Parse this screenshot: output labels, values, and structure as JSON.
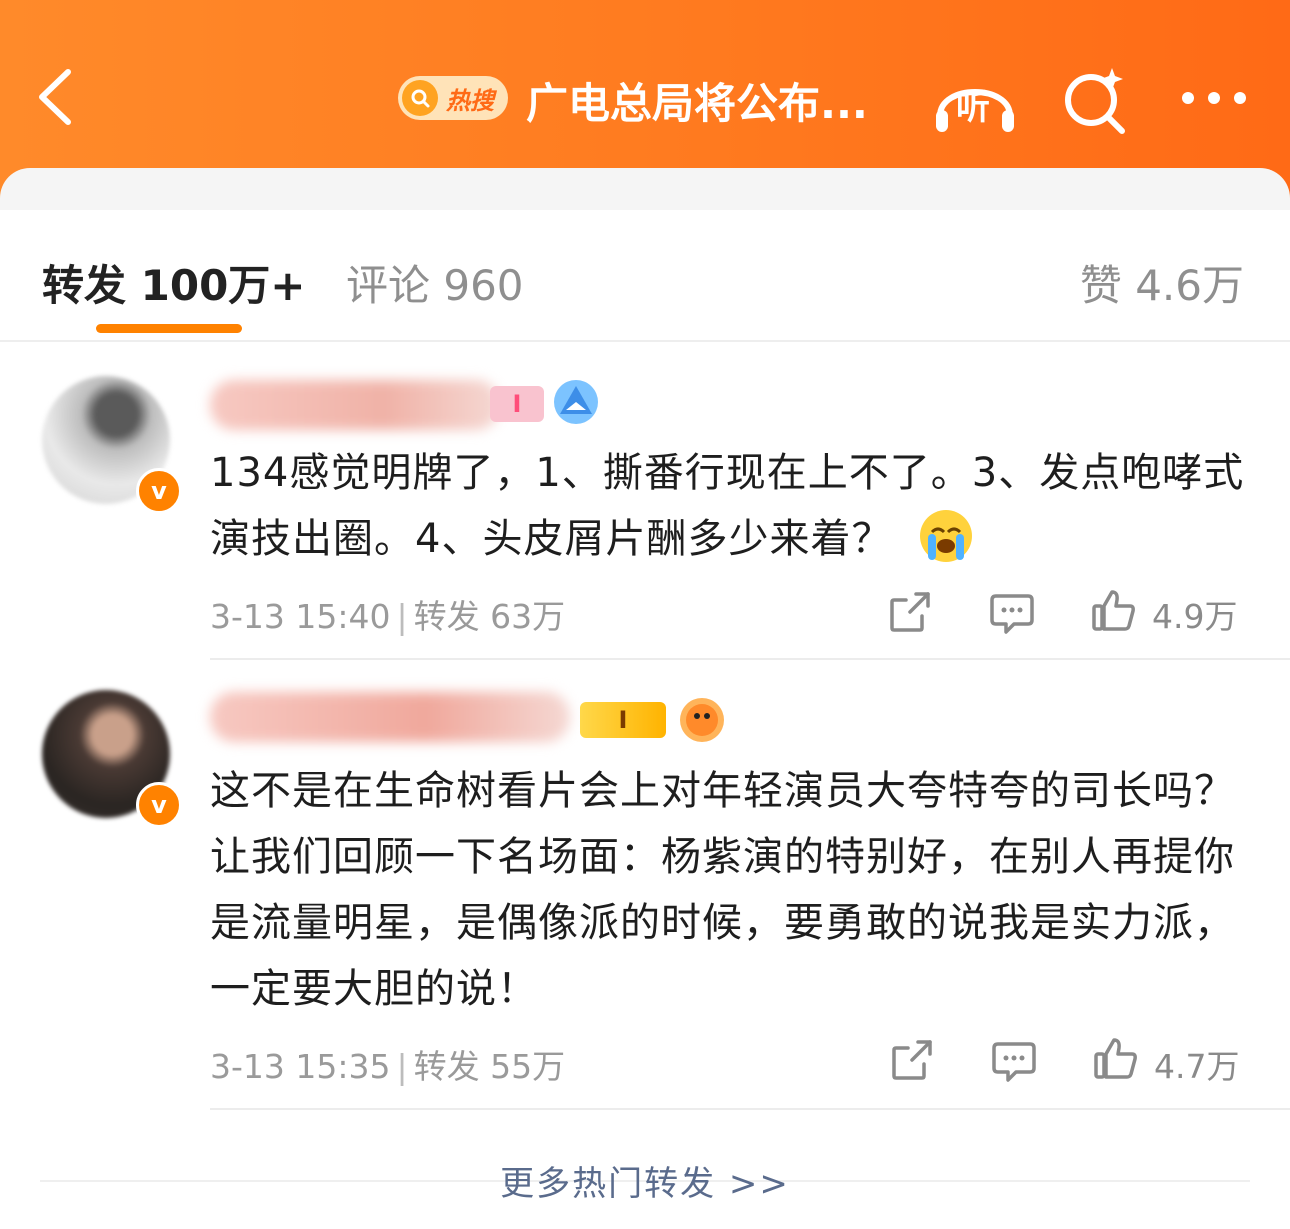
{
  "header": {
    "hot_tag_label": "热搜",
    "title": "广电总局将公布...",
    "listen_label": "听",
    "colors": {
      "bg_start": "#ff8a2a",
      "bg_end": "#ff6a16",
      "hot_tag_bg": "#ffe3b8"
    },
    "icons": [
      "back-arrow-icon",
      "search-icon",
      "headphones-icon",
      "sparkle-search-icon",
      "more-dots-icon"
    ]
  },
  "tabs": {
    "repost": "转发 100万+",
    "comment": "评论 960",
    "like": "赞 4.6万",
    "active": "repost",
    "accent": "#ff8200"
  },
  "posts": [
    {
      "text": "134感觉明牌了，1、撕番行现在上不了。3、发点咆哮式演技出圈。4、头皮屑片酬多少来着？",
      "emoji": "crying-face",
      "time": "3-13 15:40",
      "repost_count": "转发 63万",
      "likes": "4.9万",
      "level_badge": "I"
    },
    {
      "text": "这不是在生命树看片会上对年轻演员大夸特夸的司长吗？让我们回顾一下名场面：杨紫演的特别好，在别人再提你是流量明星，是偶像派的时候，要勇敢的说我是实力派，一定要大胆的说！",
      "time": "3-13 15:35",
      "repost_count": "转发 55万",
      "likes": "4.7万",
      "level_badge": "I"
    }
  ],
  "more_link": "更多热门转发 >>"
}
